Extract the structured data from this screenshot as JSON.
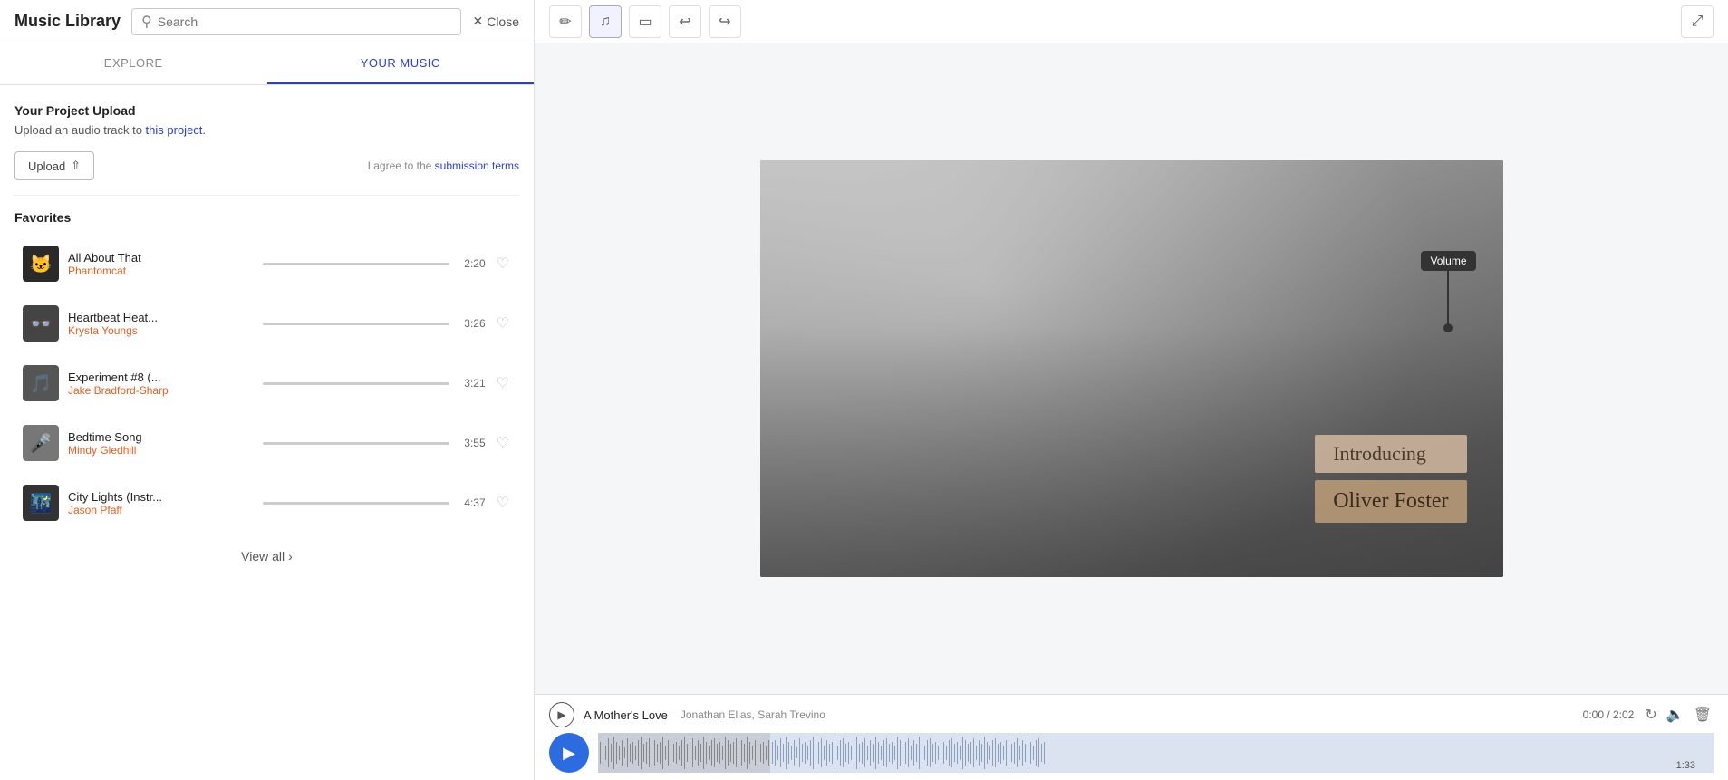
{
  "header": {
    "title": "Music Library",
    "search_placeholder": "Search",
    "close_label": "Close"
  },
  "tabs": [
    {
      "id": "explore",
      "label": "EXPLORE"
    },
    {
      "id": "your-music",
      "label": "YOUR MUSIC",
      "active": true
    }
  ],
  "upload_section": {
    "title": "Your Project Upload",
    "subtitle": "Upload an audio track to this project.",
    "subtitle_link_text": "this project",
    "upload_button_label": "Upload",
    "terms_text": "I agree to the",
    "terms_link": "submission terms"
  },
  "favorites": {
    "title": "Favorites",
    "tracks": [
      {
        "name": "All About That",
        "artist": "Phantomcat",
        "duration": "2:20",
        "thumb_color": "#333",
        "thumb_letter": "🐱"
      },
      {
        "name": "Heartbeat Heat...",
        "artist": "Krysta Youngs",
        "duration": "3:26",
        "thumb_color": "#555",
        "thumb_letter": "👓"
      },
      {
        "name": "Experiment #8 (...",
        "artist": "Jake Bradford-Sharp",
        "duration": "3:21",
        "thumb_color": "#666",
        "thumb_letter": "🎵"
      },
      {
        "name": "Bedtime Song",
        "artist": "Mindy Gledhill",
        "duration": "3:55",
        "thumb_color": "#888",
        "thumb_letter": "🎤"
      },
      {
        "name": "City Lights (Instr...",
        "artist": "Jason Pfaff",
        "duration": "4:37",
        "thumb_color": "#777",
        "thumb_letter": "🌃"
      }
    ]
  },
  "view_all_label": "View all",
  "toolbar": {
    "pencil_icon": "✏️",
    "music_icon": "♫",
    "image_icon": "⬜",
    "undo_icon": "↩",
    "redo_icon": "↪",
    "export_icon": "⤢"
  },
  "video_overlay": {
    "intro_text": "Introducing",
    "name_text": "Oliver Foster"
  },
  "volume_tooltip": "Volume",
  "track_bar": {
    "track_name": "A Mother's Love",
    "artists": "Jonathan Elias, Sarah Trevino",
    "time_current": "0:00",
    "time_total": "2:02",
    "time_display": "0:00 / 2:02",
    "waveform_time": "1:33"
  }
}
